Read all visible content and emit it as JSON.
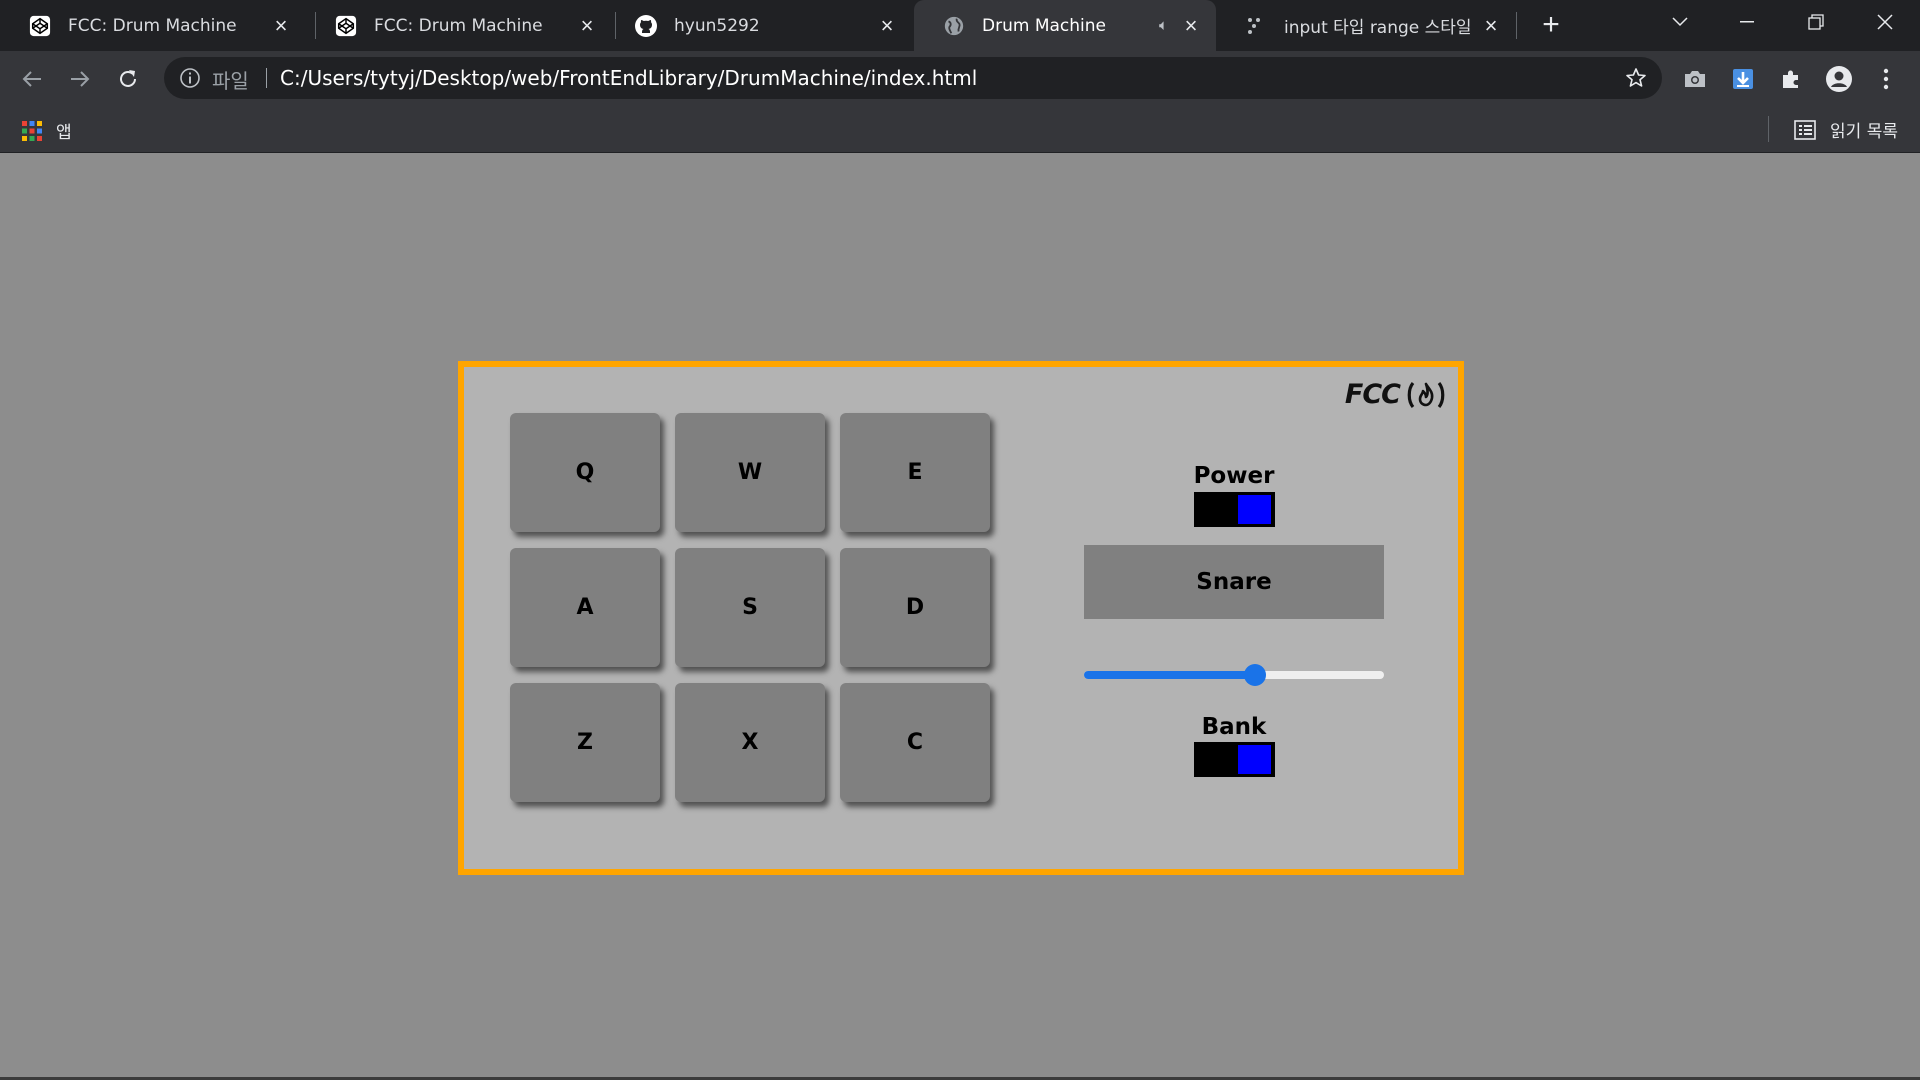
{
  "browser": {
    "tabs": [
      {
        "title": "FCC: Drum Machine",
        "icon": "codepen-icon",
        "active": false
      },
      {
        "title": "FCC: Drum Machine",
        "icon": "codepen-icon",
        "active": false
      },
      {
        "title": "hyun5292",
        "icon": "github-icon",
        "active": false
      },
      {
        "title": "Drum Machine",
        "icon": "globe-icon",
        "active": true,
        "audio": true
      },
      {
        "title": "input 타입 range 스타일",
        "icon": "dots-icon",
        "active": false
      }
    ],
    "address": {
      "scheme_label": "파일",
      "url": "C:/Users/tytyj/Desktop/web/FrontEndLibrary/DrumMachine/index.html"
    },
    "bookmarks": {
      "apps_label": "앱",
      "reading_list_label": "읽기 목록"
    },
    "accent": "#1a73e8"
  },
  "drum_machine": {
    "logo_text": "FCC",
    "pads": [
      {
        "key": "Q"
      },
      {
        "key": "W"
      },
      {
        "key": "E"
      },
      {
        "key": "A"
      },
      {
        "key": "S"
      },
      {
        "key": "D"
      },
      {
        "key": "Z"
      },
      {
        "key": "X"
      },
      {
        "key": "C"
      }
    ],
    "power": {
      "label": "Power",
      "on": true
    },
    "display_text": "Snare",
    "volume": {
      "value": 0.57
    },
    "bank": {
      "label": "Bank",
      "on": true
    },
    "colors": {
      "border": "#ffa500",
      "panel": "#b3b3b3",
      "pad": "#808080",
      "toggle_knob": "#0000ff"
    }
  }
}
